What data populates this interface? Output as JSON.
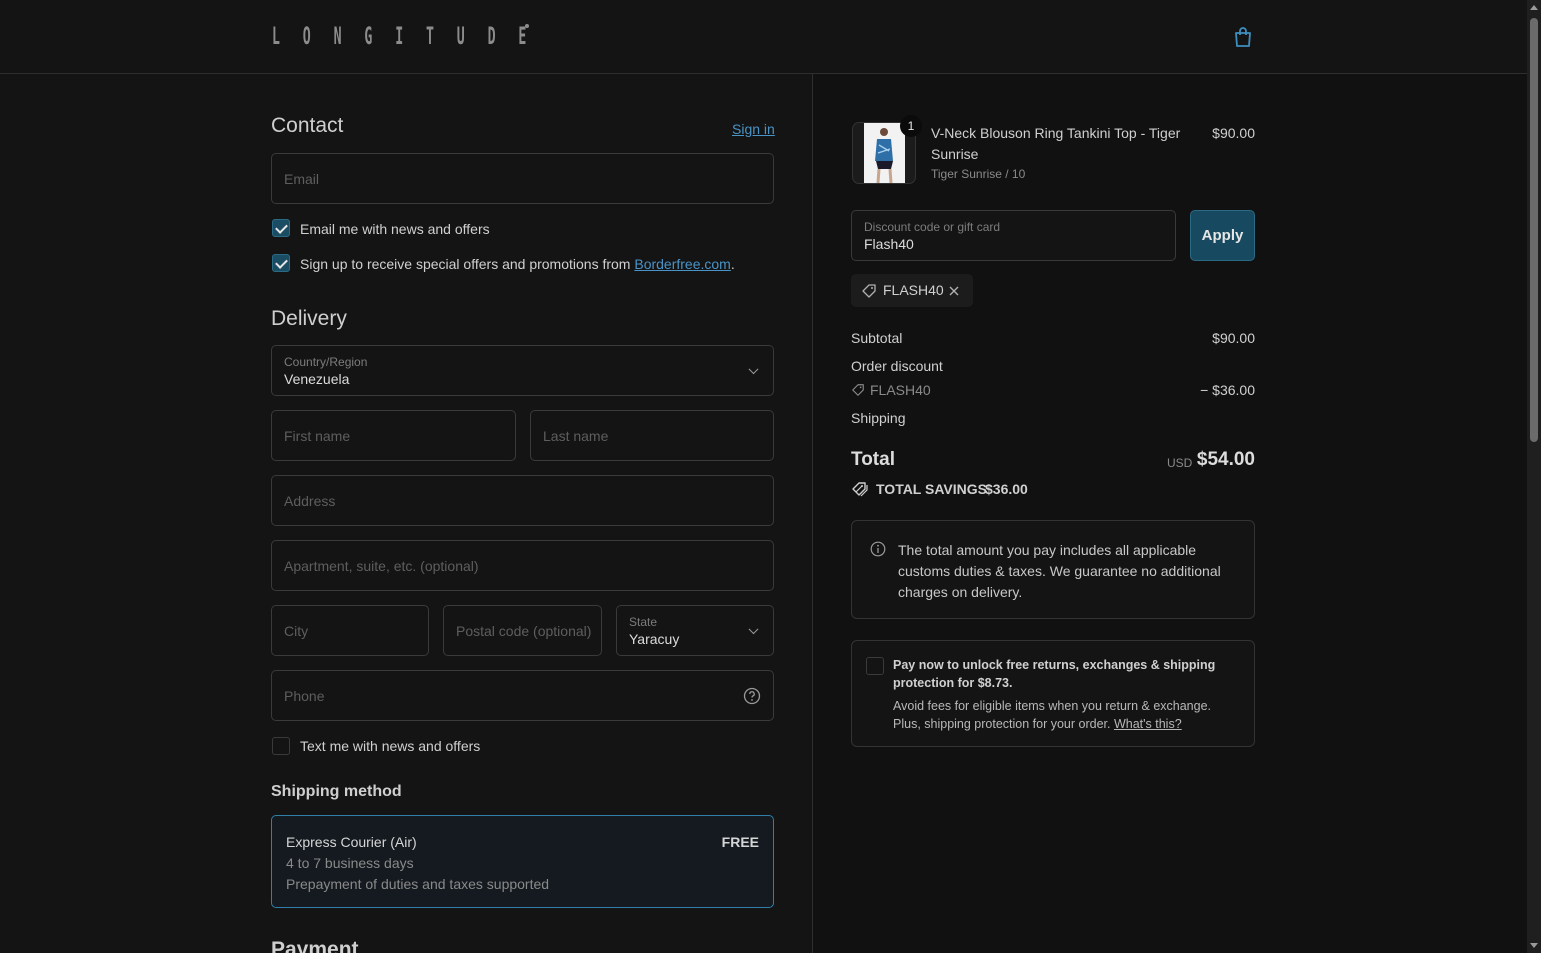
{
  "header": {
    "logo_letters": [
      "L",
      "O",
      "N",
      "G",
      "I",
      "T",
      "U",
      "D",
      "E"
    ],
    "cart_icon": "shopping-bag-icon"
  },
  "contact": {
    "title": "Contact",
    "sign_in": "Sign in",
    "email_placeholder": "Email",
    "news_checkbox": {
      "label": "Email me with news and offers",
      "checked": true
    },
    "borderfree_checkbox": {
      "label_prefix": "Sign up to receive special offers and promotions from ",
      "link": "Borderfree.com",
      "label_suffix": ".",
      "checked": true
    }
  },
  "delivery": {
    "title": "Delivery",
    "country_label": "Country/Region",
    "country_value": "Venezuela",
    "first_name_placeholder": "First name",
    "last_name_placeholder": "Last name",
    "address_placeholder": "Address",
    "apartment_placeholder": "Apartment, suite, etc. (optional)",
    "city_placeholder": "City",
    "postal_placeholder": "Postal code (optional)",
    "state_label": "State",
    "state_value": "Yaracuy",
    "phone_placeholder": "Phone",
    "text_checkbox": {
      "label": "Text me with news and offers",
      "checked": false
    }
  },
  "shipping": {
    "title": "Shipping method",
    "option_name": "Express Courier (Air)",
    "option_price": "FREE",
    "option_days": "4 to 7 business days",
    "option_note": "Prepayment of duties and taxes supported"
  },
  "payment": {
    "title": "Payment"
  },
  "summary": {
    "item": {
      "quantity": "1",
      "name_line1": "V-Neck Blouson Ring Tankini Top - Tiger",
      "name_line2": "Sunrise",
      "variant": "Tiger Sunrise / 10",
      "price": "$90.00"
    },
    "discount_label": "Discount code or gift card",
    "discount_value": "Flash40",
    "apply": "Apply",
    "chip_code": "FLASH40",
    "subtotal_label": "Subtotal",
    "subtotal_value": "$90.00",
    "order_discount_label": "Order discount",
    "discount_code": "FLASH40",
    "discount_amount": "− $36.00",
    "shipping_label": "Shipping",
    "total_label": "Total",
    "currency": "USD",
    "total_value": "$54.00",
    "savings_label": "TOTAL SAVINGS",
    "savings_value": "$36.00",
    "info_text": "The total amount you pay includes all applicable customs duties & taxes. We guarantee no additional charges on delivery.",
    "protection_title": "Pay now to unlock free returns, exchanges & shipping protection for $8.73.",
    "protection_body": "Avoid fees for eligible items when you return & exchange. Plus, shipping protection for your order.",
    "protection_link": "What's this?"
  },
  "colors": {
    "accent": "#174a60",
    "link": "#4a93c7",
    "background": "#141414"
  }
}
